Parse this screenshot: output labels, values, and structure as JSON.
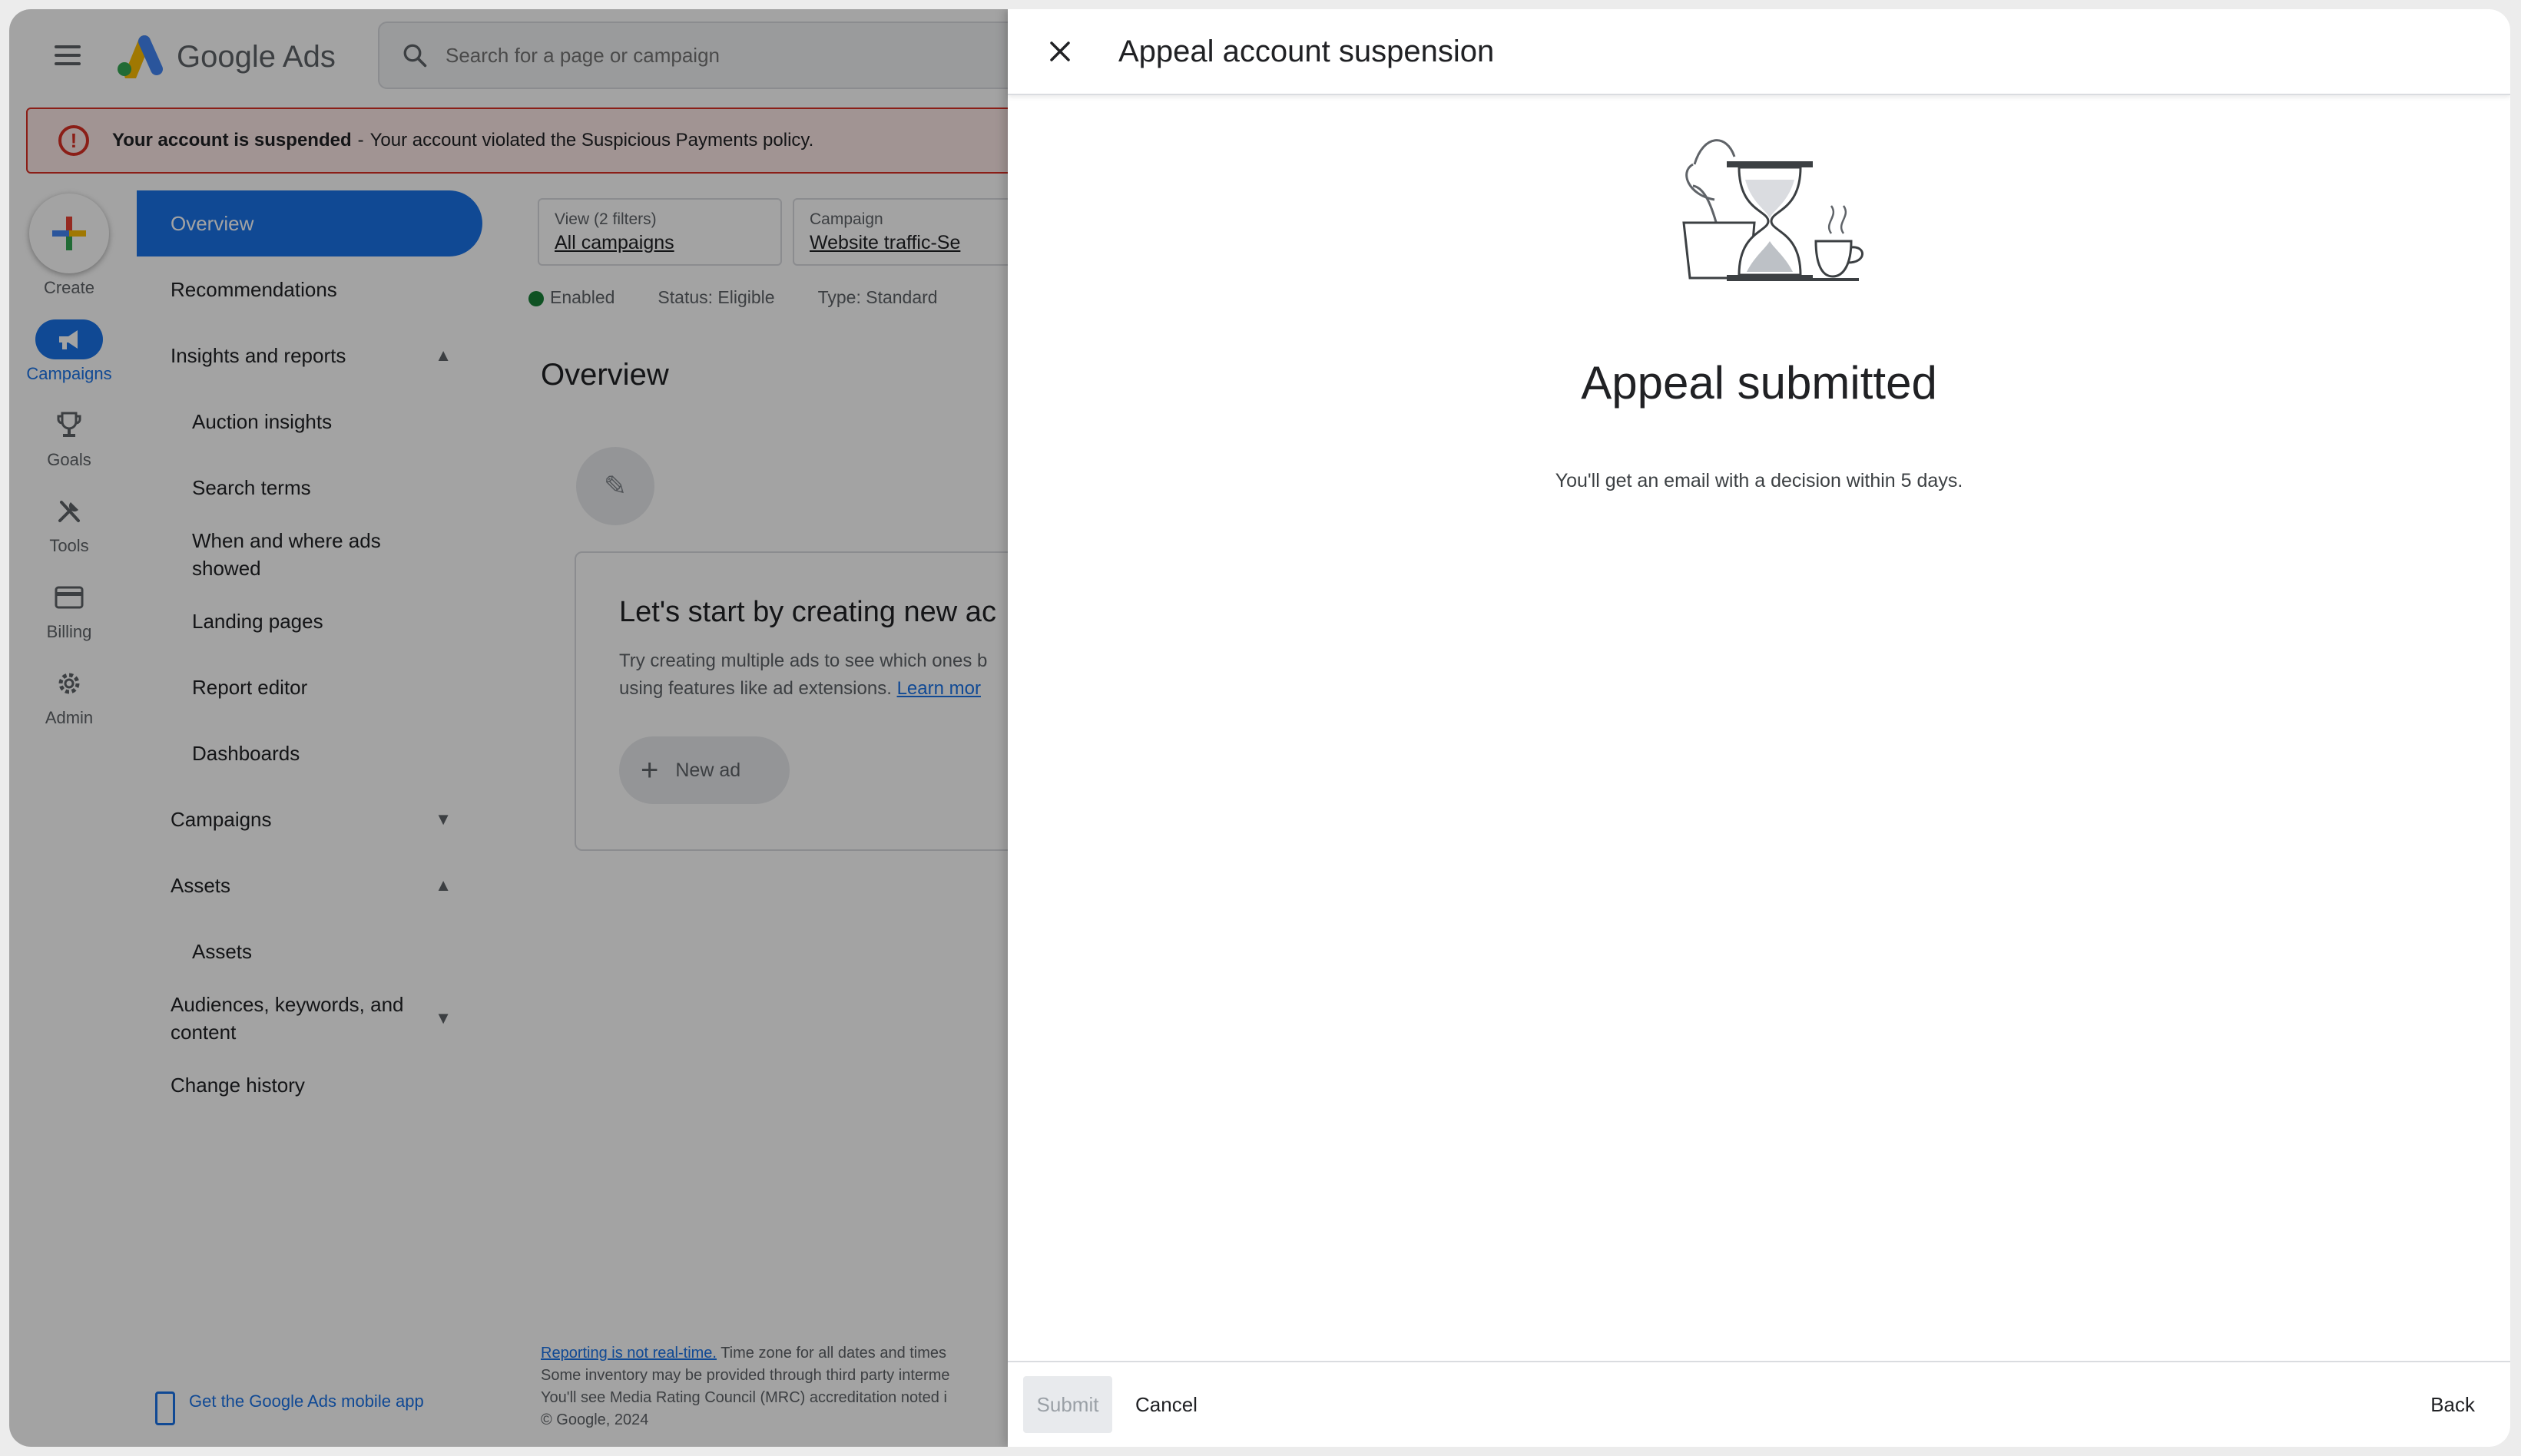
{
  "app": {
    "name": "Google Ads",
    "search_placeholder": "Search for a page or campaign"
  },
  "alert": {
    "icon": "exclamation-circle-icon",
    "title": "Your account is suspended",
    "separator": "-",
    "message": "Your account violated the Suspicious Payments policy."
  },
  "rail": {
    "create": "Create",
    "campaigns": "Campaigns",
    "goals": "Goals",
    "tools": "Tools",
    "billing": "Billing",
    "admin": "Admin"
  },
  "nav": {
    "overview": "Overview",
    "recommendations": "Recommendations",
    "insights": "Insights and reports",
    "auction": "Auction insights",
    "search_terms": "Search terms",
    "when_where": "When and where ads showed",
    "landing": "Landing pages",
    "report_editor": "Report editor",
    "dashboards": "Dashboards",
    "campaigns": "Campaigns",
    "assets_group": "Assets",
    "assets": "Assets",
    "audiences": "Audiences, keywords, and content",
    "change_history": "Change history",
    "mobile_app": "Get the Google Ads mobile app"
  },
  "filters": {
    "view_caption": "View (2 filters)",
    "view_value": "All campaigns",
    "campaign_caption": "Campaign",
    "campaign_value": "Website traffic-Se"
  },
  "status": {
    "enabled": "Enabled",
    "status_label": "Status:",
    "status_value": "Eligible",
    "type_label": "Type:",
    "type_value": "Standard"
  },
  "main": {
    "heading": "Overview",
    "card_title": "Let's start by creating new ac",
    "card_body_1": "Try creating multiple ads to see which ones b",
    "card_body_2": "using features like ad extensions.",
    "card_link": "Learn mor",
    "new_ad": "New ad"
  },
  "footer": {
    "line1_link": "Reporting is not real-time.",
    "line1_rest": "Time zone for all dates and times",
    "line2": "Some inventory may be provided through third party interme",
    "line3": "You'll see Media Rating Council (MRC) accreditation noted i",
    "copyright": "© Google, 2024"
  },
  "panel": {
    "title": "Appeal account suspension",
    "success_title": "Appeal submitted",
    "success_message": "You'll get an email with a decision within 5 days.",
    "submit": "Submit",
    "cancel": "Cancel",
    "back": "Back"
  },
  "colors": {
    "primary": "#1a73e8",
    "error": "#d93025",
    "enabled_dot": "#188038"
  }
}
